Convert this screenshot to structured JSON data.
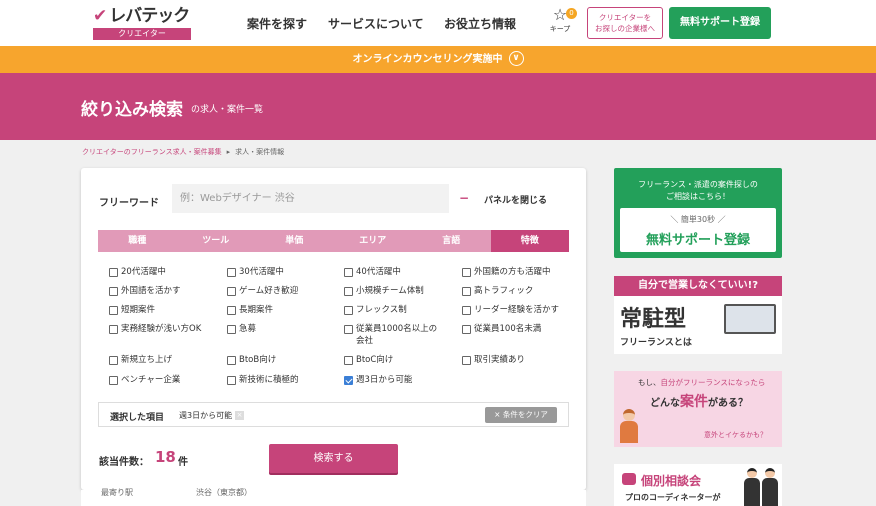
{
  "header": {
    "logo_text": "レバテック",
    "logo_sub": "クリエイター",
    "nav": [
      "案件を探す",
      "サービスについて",
      "お役立ち情報"
    ],
    "keep_label": "キープ",
    "keep_count": "0",
    "client_button_line1": "クリエイターを",
    "client_button_line2": "お探しの企業様へ",
    "register_button": "無料サポート登録"
  },
  "counseling_bar": "オンラインカウンセリング実施中",
  "page_banner": {
    "title": "絞り込み検索",
    "subtitle": "の求人・案件一覧"
  },
  "breadcrumb": {
    "link": "クリエイターのフリーランス求人・案件募集",
    "separator": "▸",
    "current": "求人・案件情報"
  },
  "search_panel": {
    "freeword_label": "フリーワード",
    "freeword_placeholder": "例：Webデザイナー 渋谷",
    "freeword_value": "",
    "close_symbol": "−",
    "close_label": "パネルを閉じる",
    "tabs": [
      {
        "label": "職種",
        "active": false
      },
      {
        "label": "ツール",
        "active": false
      },
      {
        "label": "単価",
        "active": false
      },
      {
        "label": "エリア",
        "active": false
      },
      {
        "label": "言語",
        "active": false
      },
      {
        "label": "特徴",
        "active": true
      }
    ],
    "features": [
      {
        "label": "20代活躍中",
        "checked": false
      },
      {
        "label": "30代活躍中",
        "checked": false
      },
      {
        "label": "40代活躍中",
        "checked": false
      },
      {
        "label": "外国籍の方も活躍中",
        "checked": false
      },
      {
        "label": "外国語を活かす",
        "checked": false
      },
      {
        "label": "ゲーム好き歓迎",
        "checked": false
      },
      {
        "label": "小規模チーム体制",
        "checked": false
      },
      {
        "label": "高トラフィック",
        "checked": false
      },
      {
        "label": "短期案件",
        "checked": false
      },
      {
        "label": "長期案件",
        "checked": false
      },
      {
        "label": "フレックス制",
        "checked": false
      },
      {
        "label": "リーダー経験を活かす",
        "checked": false
      },
      {
        "label": "実務経験が浅い方OK",
        "checked": false
      },
      {
        "label": "急募",
        "checked": false
      },
      {
        "label": "従業員1000名以上の",
        "label2": "会社",
        "checked": false
      },
      {
        "label": "従業員100名未満",
        "checked": false
      },
      {
        "label": "新規立ち上げ",
        "checked": false
      },
      {
        "label": "BtoB向け",
        "checked": false
      },
      {
        "label": "BtoC向け",
        "checked": false
      },
      {
        "label": "取引実績あり",
        "checked": false
      },
      {
        "label": "ベンチャー企業",
        "checked": false
      },
      {
        "label": "新技術に積極的",
        "checked": false
      },
      {
        "label": "週3日から可能",
        "checked": true
      }
    ],
    "selected_label": "選択した項目",
    "selected_chip": "週3日から可能",
    "clear_button": "× 条件をクリア",
    "count_label": "該当件数：",
    "count_value": "18",
    "count_unit": "件",
    "search_button": "検索する"
  },
  "below_panel": {
    "label": "最寄り駅",
    "value": "渋谷（東京都）"
  },
  "sidebar": {
    "ad1": {
      "line1": "フリーランス・派遣の案件探しの",
      "line2": "ご相談はこちら！",
      "small": "＼ 簡単30秒 ／",
      "main": "無料サポート登録"
    },
    "ad2": {
      "top": "自分で営業しなくていい!?",
      "main": "常駐型",
      "sub": "フリーランスとは"
    },
    "ad3": {
      "line1_pre": "もし、",
      "line1_hl": "自分がフリーランスになったら",
      "line2_pre": "どんな",
      "line2_hl": "案件",
      "line2_post": "がある？",
      "line3": "意外とイケるかも？"
    },
    "ad4": {
      "title": "個別相談会",
      "sub": "プロのコーディネーターが"
    }
  },
  "colors": {
    "brand_pink": "#c6447a",
    "tab_inactive": "#e19ab8",
    "green": "#23a05a",
    "orange": "#f7a52d",
    "check_blue": "#3b7fd6"
  }
}
